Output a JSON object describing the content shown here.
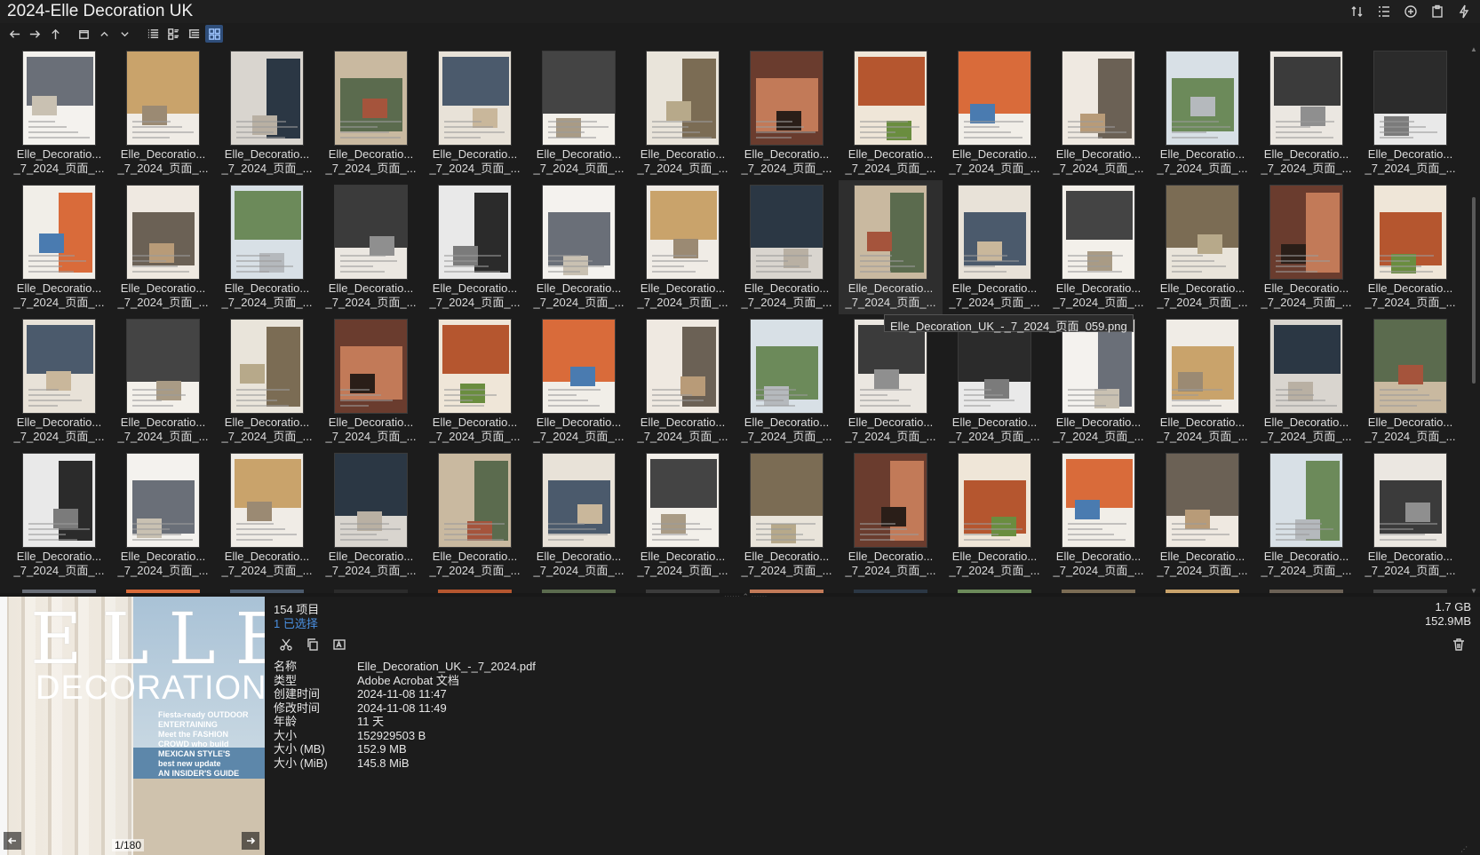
{
  "window": {
    "title": "2024-Elle Decoration UK"
  },
  "icons": {
    "sort": "sort-icon",
    "list-settings": "list-settings-icon",
    "add": "add-icon",
    "clipboard": "clipboard-icon",
    "flash": "flash-icon",
    "back": "arrow-left-icon",
    "forward": "arrow-right-icon",
    "up": "arrow-up-icon"
  },
  "grid": {
    "label_line1": "Elle_Decoratio...",
    "label_line2": "_7_2024_页面_...",
    "columns": 14,
    "rows": 4,
    "selected_index": 22,
    "tooltip": "Elle_Decoration_UK_-_7_2024_页面_059.png"
  },
  "status": {
    "item_count": "154 项目",
    "selected_count": "1 已选择",
    "total_size": "1.7 GB",
    "selected_size": "152.9MB"
  },
  "preview": {
    "page_indicator": "1/180",
    "cover_logo": "ELLE",
    "cover_sub": "DECORATION",
    "cover_lines": [
      "Fiesta-ready OUTDOOR",
      "ENTERTAINING",
      "Meet the FASHION",
      "CROWD who build",
      "MEXICAN STYLE'S",
      "best new update",
      "AN INSIDER'S GUIDE"
    ]
  },
  "properties": [
    {
      "key": "名称",
      "value": "Elle_Decoration_UK_-_7_2024.pdf"
    },
    {
      "key": "类型",
      "value": "Adobe Acrobat 文档"
    },
    {
      "key": "创建时间",
      "value": "2024-11-08  11:47"
    },
    {
      "key": "修改时间",
      "value": "2024-11-08  11:49"
    },
    {
      "key": "年龄",
      "value": "11 天"
    },
    {
      "key": "大小",
      "value": "152929503 B"
    },
    {
      "key": "大小 (MB)",
      "value": "152.9 MB"
    },
    {
      "key": "大小 (MiB)",
      "value": "145.8 MiB"
    }
  ]
}
